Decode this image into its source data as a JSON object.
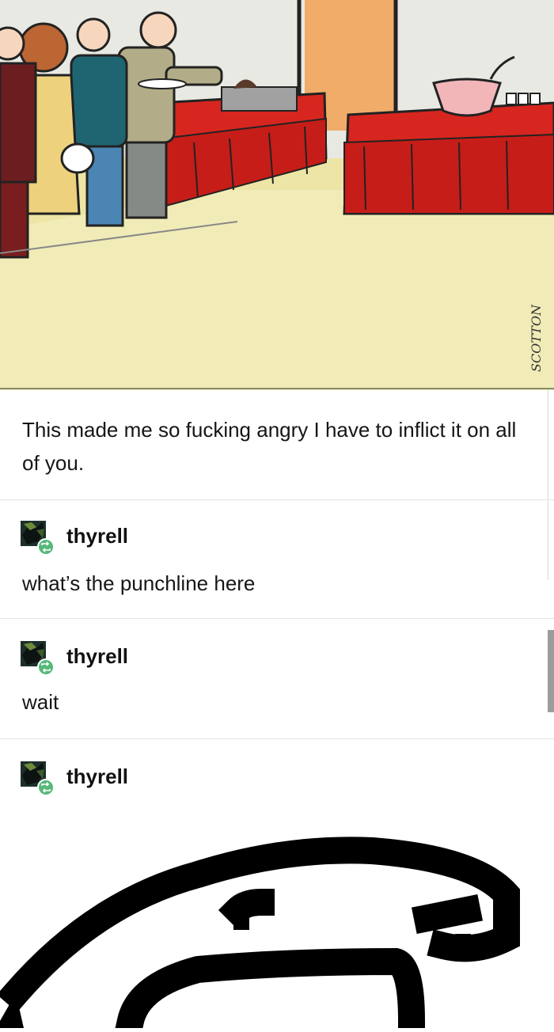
{
  "post": {
    "image_alt": "cartoon-buffet-line",
    "signature": "SCOTTON",
    "caption": "This made me so fucking angry I have to inflict it on all of you."
  },
  "reblogs": [
    {
      "username": "thyrell",
      "comment": "what’s the punchline here",
      "avatar_icon": "avatar-thyrell-icon",
      "badge_icon": "reblog-icon"
    },
    {
      "username": "thyrell",
      "comment": "wait",
      "avatar_icon": "avatar-thyrell-icon",
      "badge_icon": "reblog-icon"
    },
    {
      "username": "thyrell",
      "comment": "",
      "avatar_icon": "avatar-thyrell-icon",
      "badge_icon": "reblog-icon"
    }
  ],
  "colors": {
    "reblog_badge": "#56b97a",
    "tablecloth": "#cc1f1f",
    "floor": "#f1ecb7"
  }
}
